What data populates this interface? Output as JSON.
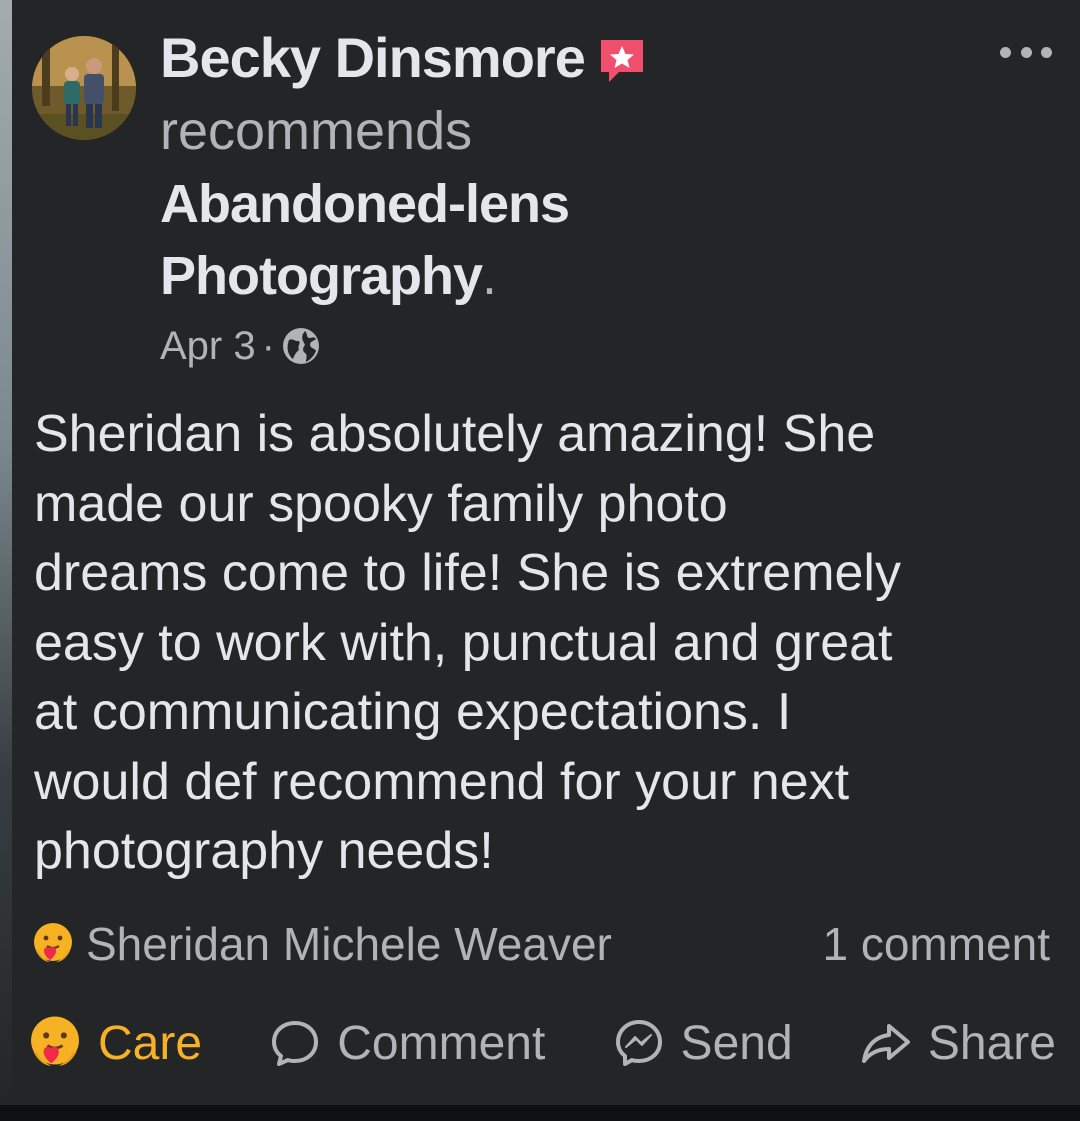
{
  "post": {
    "author": "Becky Dinsmore",
    "verb": "recommends",
    "page_name_line1": "Abandoned-lens",
    "page_name_line2": "Photography",
    "page_name_suffix": ".",
    "date": "Apr 3",
    "separator": "·",
    "privacy_icon": "globe-icon",
    "more_icon": "more-horizontal-icon",
    "badge_icon": "recommendation-star-icon",
    "body": "Sheridan is absolutely amazing! She\nmade our spooky family photo\ndreams come to life! She is extremely\neasy to work with, punctual and great\nat communicating expectations. I\nwould def recommend for your next\nphotography needs!"
  },
  "engagement": {
    "reactor_name": "Sheridan Michele Weaver",
    "reaction_icon": "care-emoji-icon",
    "comment_count": "1 comment"
  },
  "actions": {
    "care_label": "Care",
    "comment_label": "Comment",
    "send_label": "Send",
    "share_label": "Share"
  },
  "colors": {
    "background": "#242526",
    "primary_text": "#e4e6eb",
    "secondary_text": "#b0b3b8",
    "care_accent": "#f7b125",
    "badge_pink": "#f0506e"
  }
}
